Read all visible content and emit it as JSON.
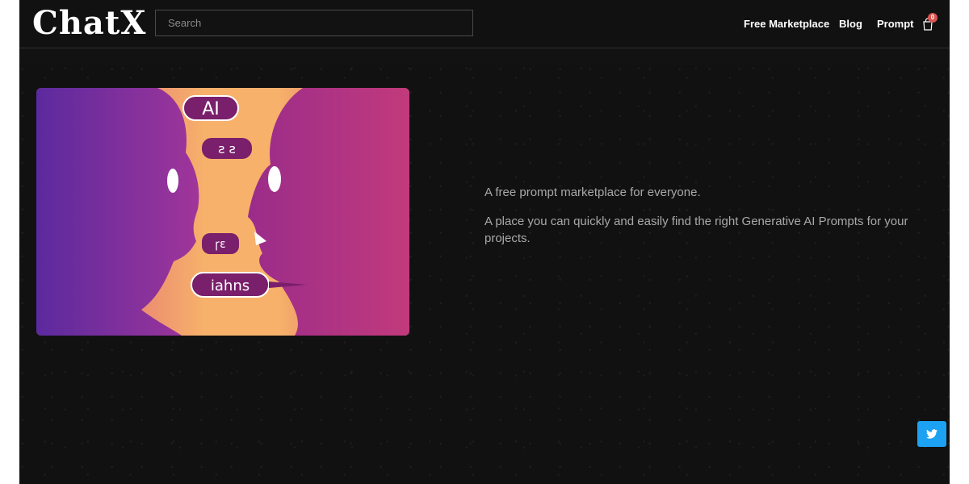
{
  "header": {
    "logo": "ChatX",
    "search": {
      "placeholder": "Search",
      "value": ""
    },
    "nav": [
      {
        "label": "Free Marketplace"
      },
      {
        "label": "Blog"
      },
      {
        "label": "Prompt"
      }
    ],
    "cart": {
      "icon": "cart-icon",
      "count": "0"
    }
  },
  "hero": {
    "image": {
      "bubbles": [
        "AI",
        "ꙅ ꙅ",
        "ꞅɛ",
        "iahns"
      ]
    },
    "paragraphs": [
      "A free prompt marketplace for everyone.",
      "A place you can quickly and easily find the right Generative AI Prompts for your projects."
    ]
  },
  "social": {
    "icon": "twitter-icon"
  },
  "colors": {
    "page_bg": "#121212",
    "text_muted": "#a9a9a9",
    "twitter": "#1da1f2",
    "badge": "#d9534f"
  }
}
